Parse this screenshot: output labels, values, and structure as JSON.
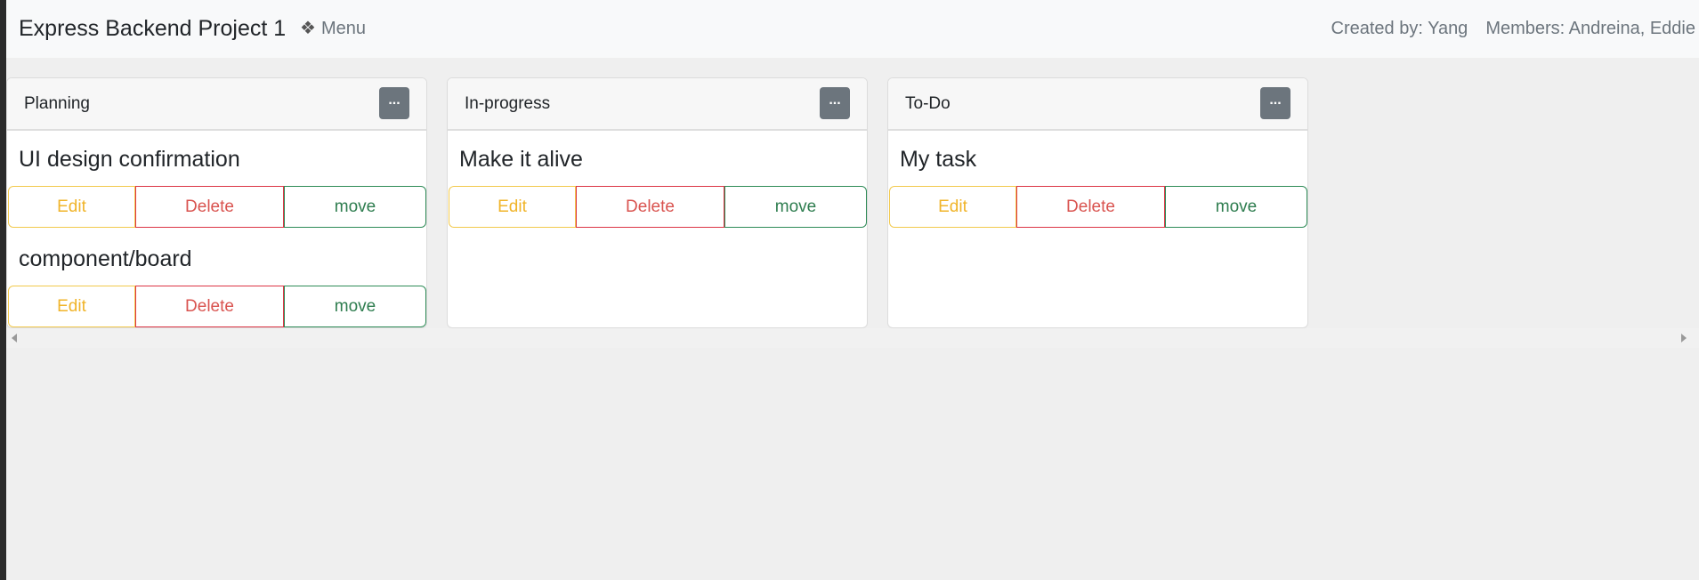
{
  "header": {
    "title": "Express Backend Project 1",
    "menu_glyph": "❖",
    "menu_label": "Menu",
    "created_by": "Created by: Yang",
    "members": "Members: Andreina, Eddie"
  },
  "lists": [
    {
      "title": "Planning",
      "options_label": "...",
      "tasks": [
        {
          "title": "UI design confirmation",
          "edit": "Edit",
          "delete": "Delete",
          "move": "move"
        },
        {
          "title": "component/board",
          "edit": "Edit",
          "delete": "Delete",
          "move": "move"
        }
      ]
    },
    {
      "title": "In-progress",
      "options_label": "...",
      "tasks": [
        {
          "title": "Make it alive",
          "edit": "Edit",
          "delete": "Delete",
          "move": "move"
        }
      ]
    },
    {
      "title": "To-Do",
      "options_label": "...",
      "tasks": [
        {
          "title": "My task",
          "edit": "Edit",
          "delete": "Delete",
          "move": "move"
        }
      ]
    }
  ],
  "colors": {
    "edit": "#f0b429",
    "delete": "#d9534f",
    "move": "#2e7d4f",
    "options_button": "#6c757d"
  }
}
